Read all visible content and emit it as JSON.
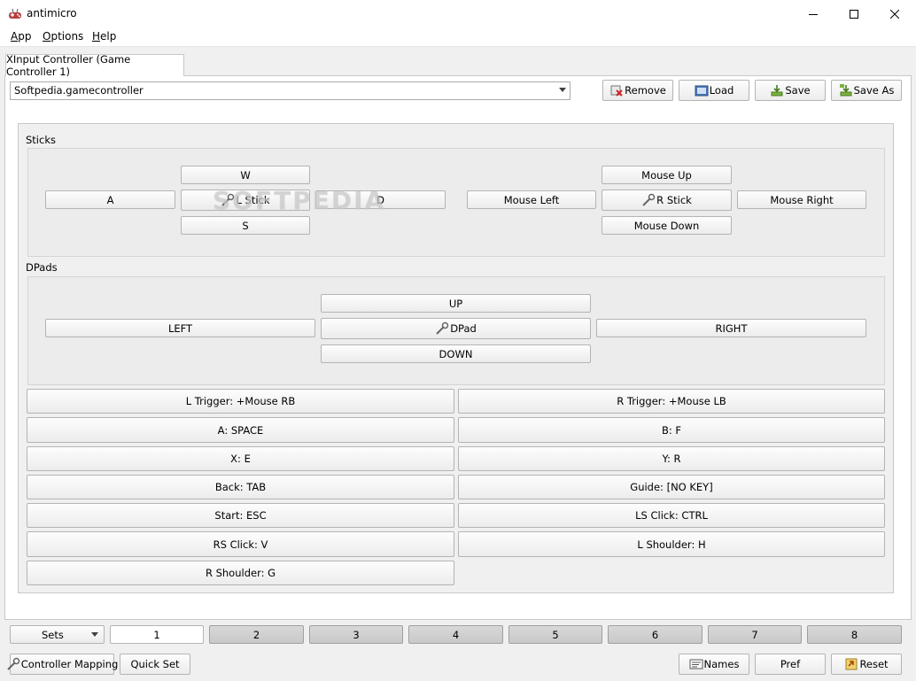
{
  "window": {
    "title": "antimicro",
    "icon": "gamepad-icon",
    "controls": {
      "minimize": "minimize-icon",
      "maximize": "maximize-icon",
      "close": "close-icon"
    }
  },
  "menu": [
    {
      "label": "App",
      "mnemonic": "A",
      "rest": "pp"
    },
    {
      "label": "Options",
      "mnemonic": "O",
      "rest": "ptions"
    },
    {
      "label": "Help",
      "mnemonic": "H",
      "rest": "elp"
    }
  ],
  "tab": {
    "label": "XInput Controller (Game Controller 1)"
  },
  "profile": {
    "selected": "Softpedia.gamecontroller",
    "buttons": {
      "remove": {
        "label": "Remove",
        "icon": "remove-icon"
      },
      "load": {
        "label": "Load",
        "icon": "folder-icon"
      },
      "save": {
        "label": "Save",
        "icon": "save-icon"
      },
      "save_as": {
        "label": "Save As",
        "icon": "save-as-icon"
      }
    }
  },
  "sticks": {
    "label": "Sticks",
    "left": {
      "up": "W",
      "left": "A",
      "center": "L Stick",
      "right": "D",
      "down": "S"
    },
    "right": {
      "up": "Mouse Up",
      "left": "Mouse Left",
      "center": "R Stick",
      "right": "Mouse Right",
      "down": "Mouse Down"
    }
  },
  "dpads": {
    "label": "DPads",
    "up": "UP",
    "left": "LEFT",
    "center": "DPad",
    "right": "RIGHT",
    "down": "DOWN"
  },
  "mappings": {
    "left": [
      "L Trigger: +Mouse RB",
      "A: SPACE",
      "X: E",
      "Back: TAB",
      "Start: ESC",
      "RS Click: V",
      "R Shoulder: G"
    ],
    "right": [
      "R Trigger: +Mouse LB",
      "B: F",
      "Y: R",
      "Guide: [NO KEY]",
      "LS Click: CTRL",
      "L Shoulder: H"
    ]
  },
  "sets": {
    "dropdown": "Sets",
    "items": [
      "1",
      "2",
      "3",
      "4",
      "5",
      "6",
      "7",
      "8"
    ],
    "active": "1"
  },
  "bottom": {
    "controller_mapping": "Controller Mapping",
    "quick_set": "Quick Set",
    "names": "Names",
    "pref": "Pref",
    "reset": "Reset"
  },
  "watermark": "SOFTPEDIA"
}
